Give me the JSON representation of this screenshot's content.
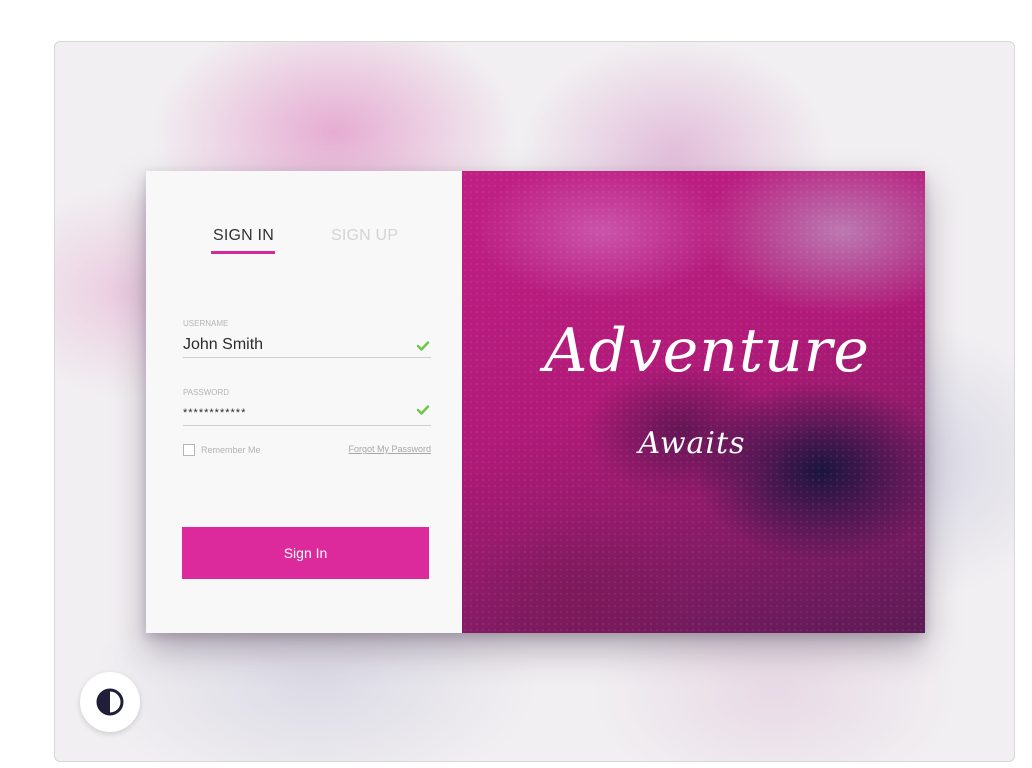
{
  "tabs": {
    "sign_in": "SIGN IN",
    "sign_up": "SIGN UP"
  },
  "form": {
    "username_label": "USERNAME",
    "username_value": "John Smith",
    "password_label": "PASSWORD",
    "password_value": "************",
    "remember_label": "Remember Me",
    "forgot_link": "Forgot My Password",
    "submit_label": "Sign In"
  },
  "hero": {
    "headline": "Adventure",
    "subline": "Awaits"
  },
  "icons": {
    "username_valid": "check-icon",
    "password_valid": "check-icon",
    "contrast_toggle": "contrast-icon"
  },
  "colors": {
    "accent": "#dc2a9d",
    "valid": "#6cc644"
  }
}
